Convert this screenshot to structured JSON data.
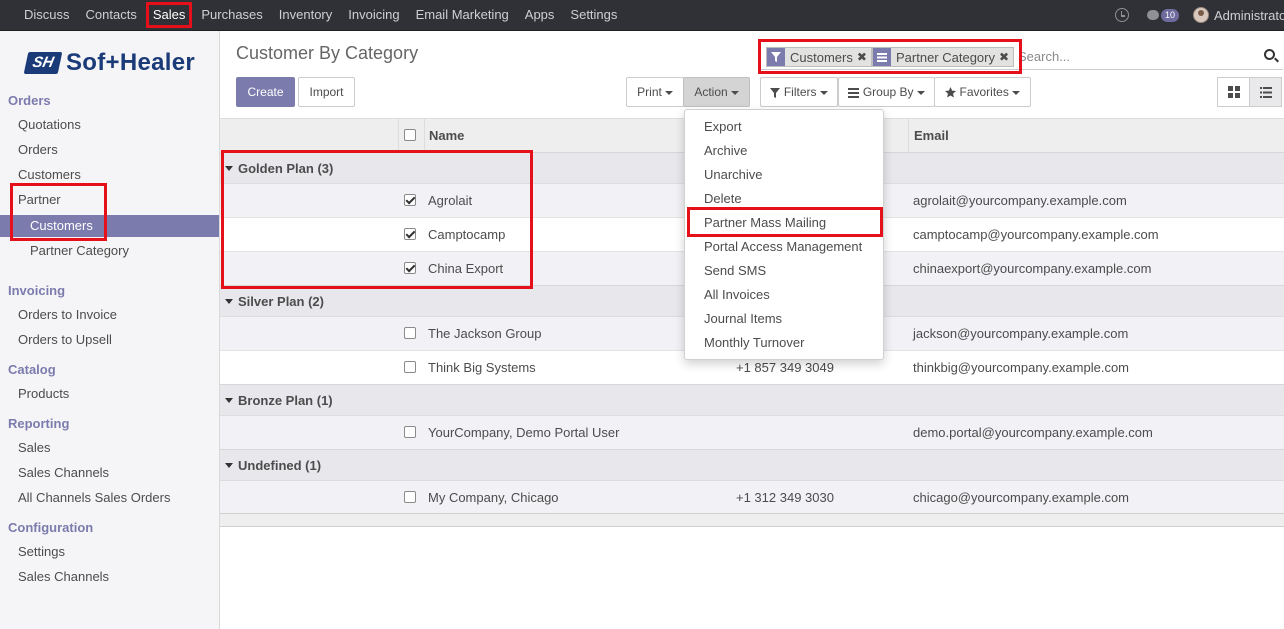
{
  "topbar": {
    "menu": [
      "Discuss",
      "Contacts",
      "Sales",
      "Purchases",
      "Inventory",
      "Invoicing",
      "Email Marketing",
      "Apps",
      "Settings"
    ],
    "active_index": 2,
    "message_count": "10",
    "user": "Administrator"
  },
  "sidebar": {
    "logo_mark": "SH",
    "logo_text": "Sof+Healer",
    "sections": [
      {
        "title": "Orders",
        "items": [
          "Quotations",
          "Orders",
          "Customers"
        ]
      },
      {
        "title": "Invoicing",
        "items": [
          "Orders to Invoice",
          "Orders to Upsell"
        ]
      },
      {
        "title": "Catalog",
        "items": [
          "Products"
        ]
      },
      {
        "title": "Reporting",
        "items": [
          "Sales",
          "Sales Channels",
          "All Channels Sales Orders"
        ]
      },
      {
        "title": "Configuration",
        "items": [
          "Settings",
          "Sales Channels"
        ]
      }
    ],
    "partner": {
      "label": "Partner",
      "children": [
        "Customers",
        "Partner Category"
      ]
    }
  },
  "control": {
    "title": "Customer By Category",
    "create": "Create",
    "import": "Import",
    "print": "Print",
    "action": "Action",
    "filters": "Filters",
    "group_by": "Group By",
    "favorites": "Favorites"
  },
  "search": {
    "facets": [
      "Customers",
      "Partner Category"
    ],
    "placeholder": "Search..."
  },
  "table": {
    "headers": {
      "name": "Name",
      "email": "Email"
    },
    "groups": [
      {
        "label": "Golden Plan (3)",
        "rows": [
          {
            "name": "Agrolait",
            "phone": "",
            "email": "agrolait@yourcompany.example.com",
            "checked": true
          },
          {
            "name": "Camptocamp",
            "phone": "",
            "email": "camptocamp@yourcompany.example.com",
            "checked": true
          },
          {
            "name": "China Export",
            "phone": "",
            "email": "chinaexport@yourcompany.example.com",
            "checked": true
          }
        ]
      },
      {
        "label": "Silver Plan (2)",
        "rows": [
          {
            "name": "The Jackson Group",
            "phone": "",
            "email": "jackson@yourcompany.example.com",
            "checked": false
          },
          {
            "name": "Think Big Systems",
            "phone": "+1 857 349 3049",
            "email": "thinkbig@yourcompany.example.com",
            "checked": false
          }
        ]
      },
      {
        "label": "Bronze Plan (1)",
        "rows": [
          {
            "name": "YourCompany, Demo Portal User",
            "phone": "",
            "email": "demo.portal@yourcompany.example.com",
            "checked": false
          }
        ]
      },
      {
        "label": "Undefined (1)",
        "rows": [
          {
            "name": "My Company, Chicago",
            "phone": "+1 312 349 3030",
            "email": "chicago@yourcompany.example.com",
            "checked": false
          }
        ]
      }
    ]
  },
  "action_menu": [
    "Export",
    "Archive",
    "Unarchive",
    "Delete",
    "Partner Mass Mailing",
    "Portal Access Management",
    "Send SMS",
    "All Invoices",
    "Journal Items",
    "Monthly Turnover"
  ],
  "colors": {
    "brand": "#7c7bad",
    "highlight": "#e5101a",
    "navbar": "#2f3136",
    "logo": "#1a3a78"
  }
}
